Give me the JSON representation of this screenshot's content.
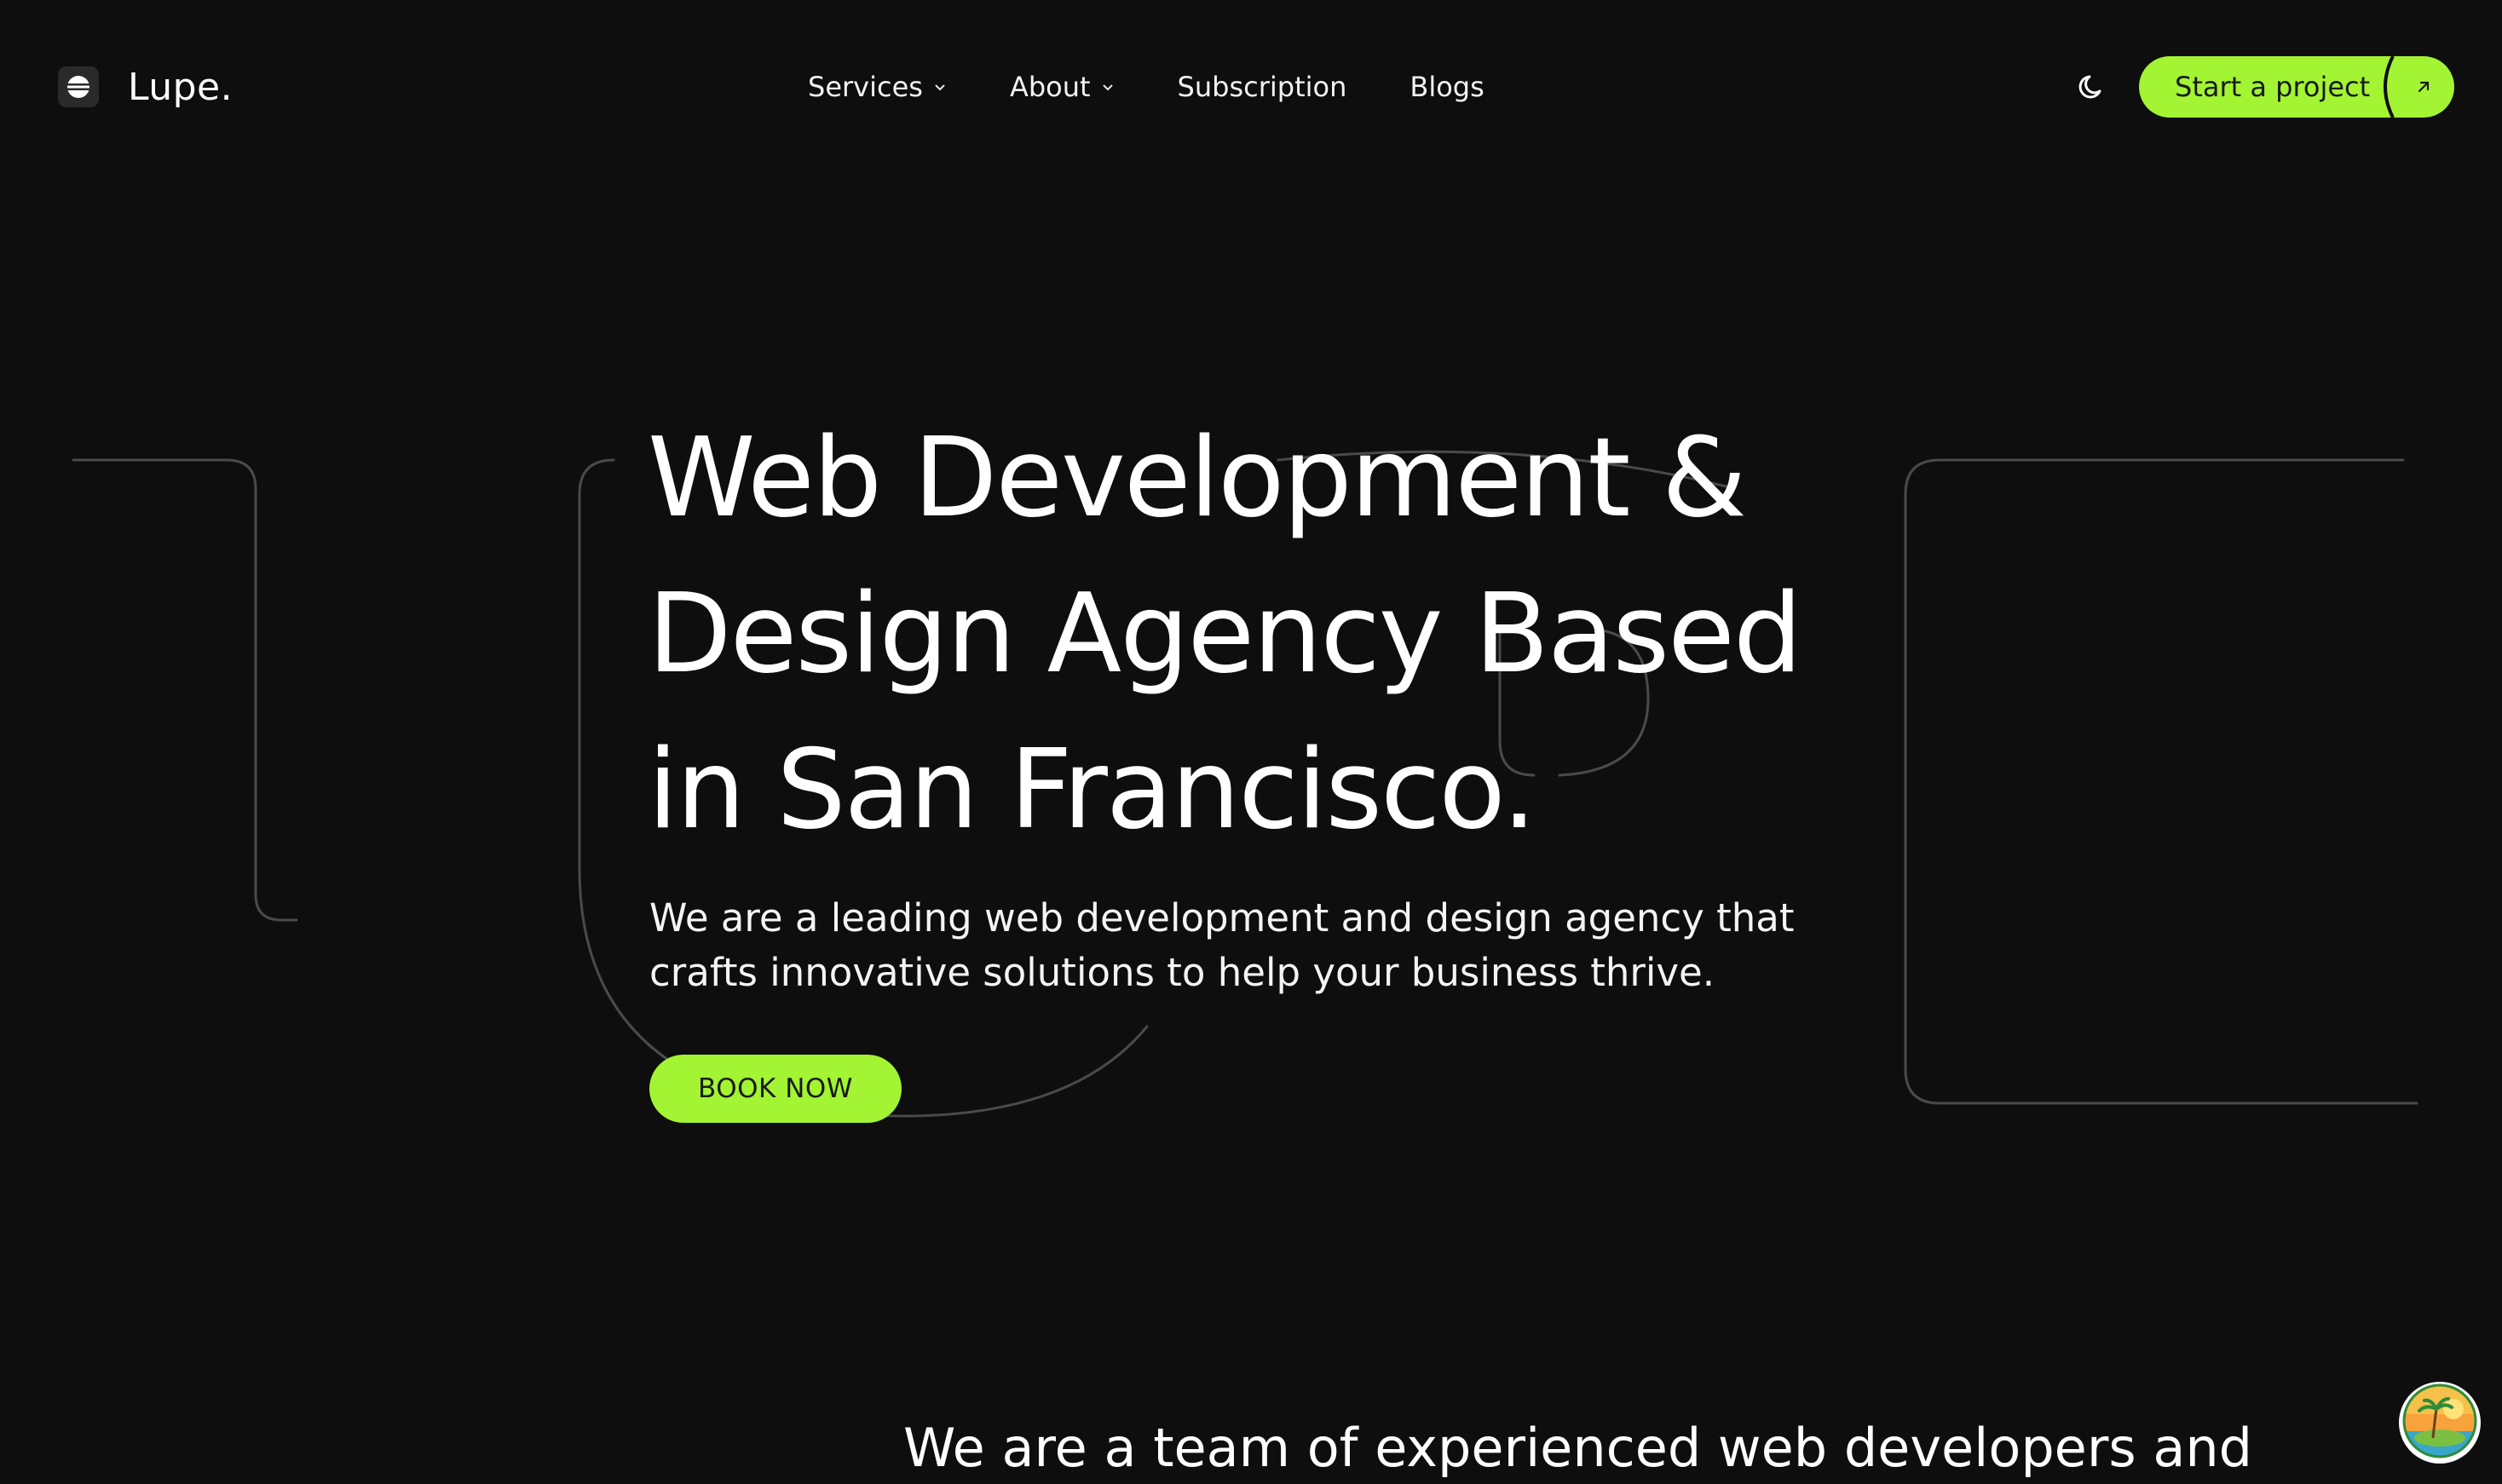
{
  "brand": {
    "name": "Lupe.",
    "accent_color": "#a3f432",
    "background_color": "#0f0e0f"
  },
  "header": {
    "logo_icon": "lupe-logo-icon",
    "nav": [
      {
        "label": "Services",
        "has_dropdown": true
      },
      {
        "label": "About",
        "has_dropdown": true
      },
      {
        "label": "Subscription",
        "has_dropdown": false
      },
      {
        "label": "Blogs",
        "has_dropdown": false
      }
    ],
    "theme_toggle_icon": "moon-icon",
    "cta_label": "Start a project",
    "cta_icon": "arrow-up-right-icon"
  },
  "hero": {
    "title_lines": [
      "Web Development &",
      "Design Agency Based",
      "in San Francisco."
    ],
    "subtitle_lines": [
      "We are a leading web development and design agency that",
      "crafts innovative solutions to help your business thrive."
    ],
    "button_label": "BOOK NOW"
  },
  "about": {
    "text": "We are a team of experienced web developers and"
  },
  "floating": {
    "avatar_icon": "beach-avatar-icon"
  }
}
